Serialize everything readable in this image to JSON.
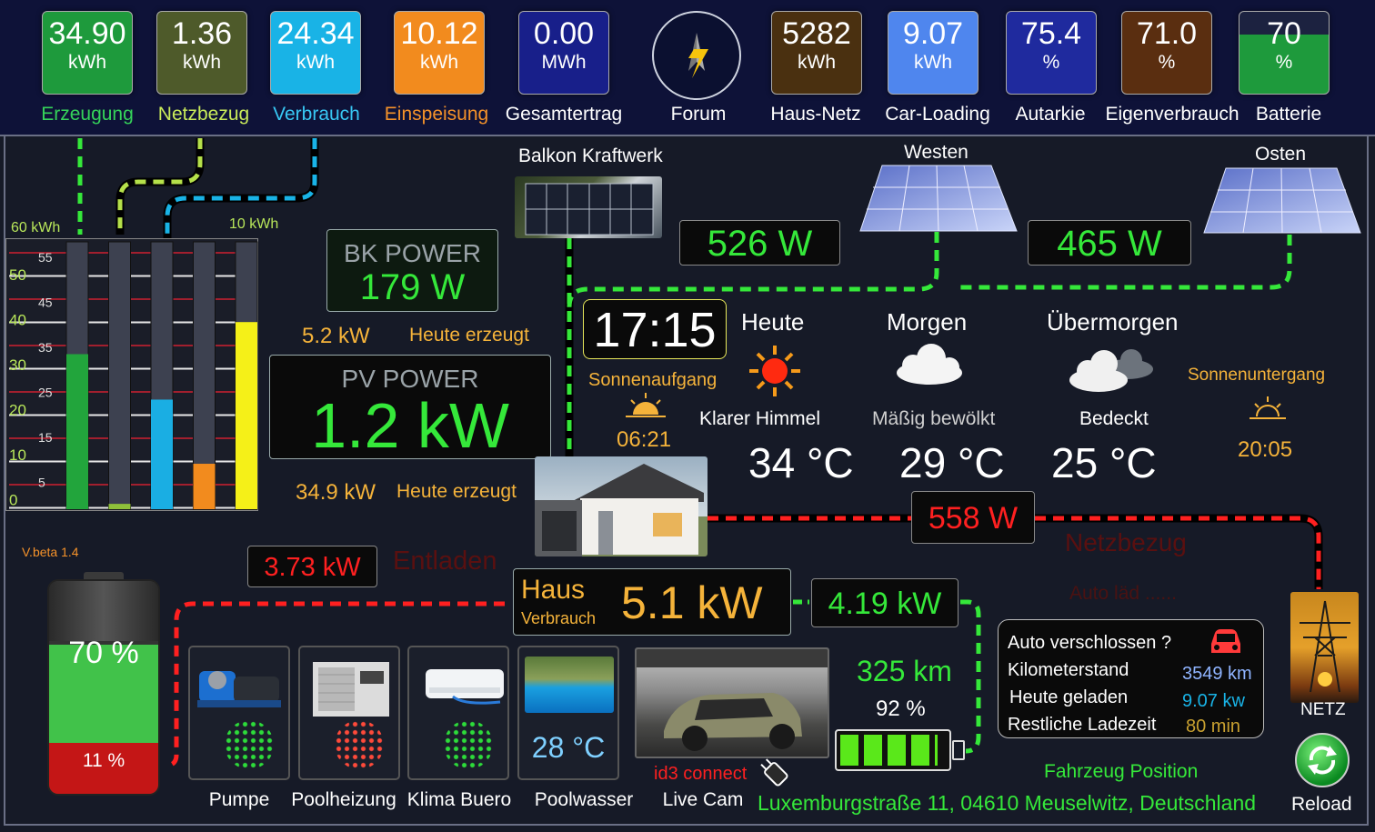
{
  "tiles": [
    {
      "value": "34.90",
      "unit": "kWh",
      "label": "Erzeugung"
    },
    {
      "value": "1.36",
      "unit": "kWh",
      "label": "Netzbezug"
    },
    {
      "value": "24.34",
      "unit": "kWh",
      "label": "Verbrauch"
    },
    {
      "value": "10.12",
      "unit": "kWh",
      "label": "Einspeisung"
    },
    {
      "value": "0.00",
      "unit": "MWh",
      "label": "Gesamtertrag"
    },
    {
      "value": "",
      "unit": "",
      "label": "Forum"
    },
    {
      "value": "5282",
      "unit": "kWh",
      "label": "Haus-Netz"
    },
    {
      "value": "9.07",
      "unit": "kWh",
      "label": "Car-Loading"
    },
    {
      "value": "75.4",
      "unit": "%",
      "label": "Autarkie"
    },
    {
      "value": "71.0",
      "unit": "%",
      "label": "Eigenverbrauch"
    },
    {
      "value": "70",
      "unit": "%",
      "label": "Batterie"
    }
  ],
  "colors": {
    "erzeugung": "#1e9a3c",
    "netzbezug": "#4e5a2a",
    "verbrauch": "#19b3e6",
    "einspeisung": "#f28b1e",
    "gesamtertrag": "#181f8a",
    "hausnetz": "#4a3010",
    "carloading": "#4f86ee",
    "autarkie": "#1f2a9e",
    "eigenverbrauch": "#5a2e10",
    "green": "#35e83a",
    "red": "#ff2020",
    "orange": "#f5b33a"
  },
  "bar_chart": {
    "top_left_label": "60 kWh",
    "top_right_label": "10 kWh",
    "left_ticks": [
      "50",
      "40",
      "30",
      "20",
      "10",
      "0"
    ],
    "right_ticks": [
      "55",
      "45",
      "35",
      "25",
      "15",
      "5"
    ],
    "series": [
      {
        "name": "Erzeugung",
        "fraction": 0.58,
        "color": "#22a53c"
      },
      {
        "name": "Netzbezug",
        "fraction": 0.02,
        "color": "#8fc23a"
      },
      {
        "name": "Verbrauch",
        "fraction": 0.41,
        "color": "#1aaee3"
      },
      {
        "name": "Einspeisung",
        "fraction": 0.17,
        "color": "#f28b1e"
      },
      {
        "name": "Batterie",
        "fraction": 0.7,
        "color": "#f5f018"
      }
    ]
  },
  "bk_power": {
    "title": "BK POWER",
    "value": "179 W",
    "today_value": "5.2 kW",
    "today_label": "Heute erzeugt"
  },
  "pv_power": {
    "title": "PV POWER",
    "value": "1.2 kW",
    "today_value": "34.9 kW",
    "today_label": "Heute erzeugt"
  },
  "solar": {
    "balkon_title": "Balkon Kraftwerk",
    "west_title": "Westen",
    "east_title": "Osten",
    "west_power": "526 W",
    "east_power": "465 W"
  },
  "clock": {
    "time": "17:15",
    "sunrise_label": "Sonnenaufgang",
    "sunrise_time": "06:21",
    "sunset_label": "Sonnenuntergang",
    "sunset_time": "20:05"
  },
  "weather": [
    {
      "day": "Heute",
      "desc": "Klarer Himmel",
      "temp": "34 °C",
      "icon": "sun-icon"
    },
    {
      "day": "Morgen",
      "desc": "Mäßig bewölkt",
      "temp": "29 °C",
      "icon": "cloud-icon"
    },
    {
      "day": "Übermorgen",
      "desc": "Bedeckt",
      "temp": "25 °C",
      "icon": "overcast-icon"
    }
  ],
  "grid": {
    "power": "558 W",
    "label": "Netzbezug",
    "car_status": "Auto läd ......",
    "netz_label": "NETZ"
  },
  "battery": {
    "version": "V.beta 1.4",
    "power": "3.73 kW",
    "mode": "Entladen",
    "percent": "70 %",
    "low_percent": "11 %",
    "level": 0.7
  },
  "house": {
    "title": "Haus",
    "subtitle": "Verbrauch",
    "power": "5.1 kW",
    "car_power": "4.19 kW"
  },
  "devices": [
    {
      "label": "Pumpe",
      "status": "green"
    },
    {
      "label": "Poolheizung",
      "status": "red"
    },
    {
      "label": "Klima Buero",
      "status": "green"
    },
    {
      "label": "Poolwasser",
      "value": "28 °C"
    }
  ],
  "camera": {
    "label": "Live Cam",
    "connect": "id3 connect"
  },
  "car": {
    "range": "325 km",
    "soc": "92 %",
    "soc_level": 0.92,
    "locked_question": "Auto verschlossen ?",
    "km_label": "Kilometerstand",
    "km_value": "3549 km",
    "charged_label": "Heute geladen",
    "charged_value": "9.07 kw",
    "remaining_label": "Restliche Ladezeit",
    "remaining_value": "80 min",
    "position_label": "Fahrzeug Position",
    "address": "Luxemburgstraße 11, 04610 Meuselwitz, Deutschland"
  },
  "reload": {
    "label": "Reload"
  }
}
